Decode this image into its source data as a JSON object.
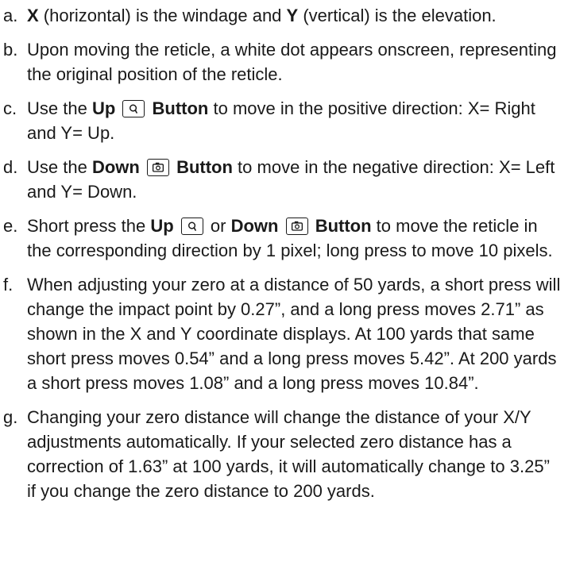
{
  "items": [
    {
      "marker": "a.",
      "parts": [
        {
          "t": "X",
          "b": true
        },
        {
          "t": " (horizontal) is the windage and "
        },
        {
          "t": "Y",
          "b": true
        },
        {
          "t": " (vertical) is the elevation."
        }
      ]
    },
    {
      "marker": "b.",
      "parts": [
        {
          "t": "Upon moving the reticle, a white dot appears onscreen, representing the original position of the reticle."
        }
      ]
    },
    {
      "marker": "c.",
      "parts": [
        {
          "t": "Use the "
        },
        {
          "t": "Up",
          "b": true
        },
        {
          "t": " "
        },
        {
          "icon": "zoom-button-icon"
        },
        {
          "t": " "
        },
        {
          "t": "Button",
          "b": true
        },
        {
          "t": " to move in the positive direction: X= Right and Y= Up."
        }
      ]
    },
    {
      "marker": "d.",
      "parts": [
        {
          "t": "Use the "
        },
        {
          "t": "Down",
          "b": true
        },
        {
          "t": " "
        },
        {
          "icon": "camera-button-icon"
        },
        {
          "t": " "
        },
        {
          "t": "Button",
          "b": true
        },
        {
          "t": " to move in the negative direction: X= Left and Y= Down."
        }
      ]
    },
    {
      "marker": "e.",
      "parts": [
        {
          "t": "Short press the "
        },
        {
          "t": "Up",
          "b": true
        },
        {
          "t": " "
        },
        {
          "icon": "zoom-button-icon"
        },
        {
          "t": " or "
        },
        {
          "t": "Down",
          "b": true
        },
        {
          "t": " "
        },
        {
          "icon": "camera-button-icon"
        },
        {
          "t": " "
        },
        {
          "t": "Button",
          "b": true
        },
        {
          "t": " to move the reticle in the corresponding direction by 1 pixel; long press to move 10 pixels."
        }
      ]
    },
    {
      "marker": "f.",
      "parts": [
        {
          "t": "When adjusting your zero at a distance of 50 yards, a short press will change the impact point by 0.27”, and a long press moves 2.71” as shown in the X and Y coordinate displays. At 100 yards that same short press moves 0.54” and a long press moves 5.42”. At 200 yards a short press moves 1.08” and a long press moves 10.84”."
        }
      ]
    },
    {
      "marker": "g.",
      "parts": [
        {
          "t": "Changing your zero distance will change the distance of your X/Y adjustments automatically. If your selected zero distance has a correction of 1.63” at 100 yards, it will automatically change to 3.25” if you change the zero distance to 200 yards."
        }
      ]
    }
  ]
}
